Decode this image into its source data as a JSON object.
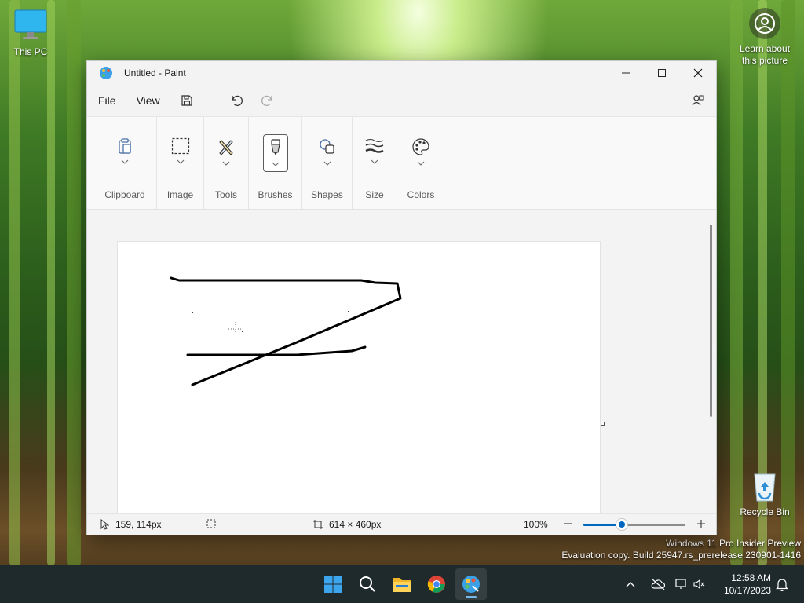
{
  "desktop": {
    "this_pc_label": "This PC",
    "recycle_bin_label": "Recycle Bin",
    "learn_line1": "Learn about",
    "learn_line2": "this picture",
    "watermark_line1": "Windows 11 Pro Insider Preview",
    "watermark_line2": "Evaluation copy. Build 25947.rs_prerelease.230901-1416"
  },
  "window": {
    "title": "Untitled - Paint",
    "menu": {
      "file": "File",
      "view": "View"
    },
    "icons": {
      "save": "save-icon",
      "undo": "undo-icon",
      "redo": "redo-icon",
      "account": "account-icon",
      "minimize": "minimize-icon",
      "maximize": "maximize-icon",
      "close": "close-icon"
    }
  },
  "ribbon": {
    "groups": [
      {
        "label": "Clipboard",
        "icon": "clipboard-icon"
      },
      {
        "label": "Image",
        "icon": "selection-icon"
      },
      {
        "label": "Tools",
        "icon": "tools-icon"
      },
      {
        "label": "Brushes",
        "icon": "brush-icon",
        "selected": true
      },
      {
        "label": "Shapes",
        "icon": "shapes-icon"
      },
      {
        "label": "Size",
        "icon": "size-icon"
      },
      {
        "label": "Colors",
        "icon": "palette-icon"
      }
    ]
  },
  "status": {
    "cursor_position": "159, 114px",
    "canvas_size": "614 × 460px",
    "zoom": "100%",
    "zoom_level_fraction": 0.38
  },
  "taskbar": {
    "pinned": [
      "windows-start-icon",
      "search-icon",
      "file-explorer-icon",
      "chrome-icon",
      "paint-icon"
    ],
    "active": "paint-icon",
    "time": "12:58 AM",
    "date": "10/17/2023"
  },
  "colors": {
    "accent": "#0067c0",
    "taskbar": "#1f2a2d"
  }
}
